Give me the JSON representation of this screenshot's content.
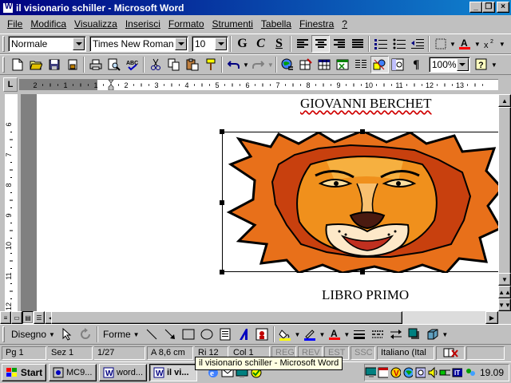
{
  "window": {
    "title": "il visionario schiller - Microsoft Word",
    "minimize_glyph": "_",
    "restore_glyph": "❐",
    "close_glyph": "×"
  },
  "menu": [
    {
      "label": "File",
      "name": "menu-file"
    },
    {
      "label": "Modifica",
      "name": "menu-modifica"
    },
    {
      "label": "Visualizza",
      "name": "menu-visualizza"
    },
    {
      "label": "Inserisci",
      "name": "menu-inserisci"
    },
    {
      "label": "Formato",
      "name": "menu-formato"
    },
    {
      "label": "Strumenti",
      "name": "menu-strumenti"
    },
    {
      "label": "Tabella",
      "name": "menu-tabella"
    },
    {
      "label": "Finestra",
      "name": "menu-finestra"
    },
    {
      "label": "?",
      "name": "menu-help"
    }
  ],
  "formatting": {
    "style": "Normale",
    "font": "Times New Roman",
    "size": "10",
    "bold": "G",
    "italic": "C",
    "underline": "S"
  },
  "standard": {
    "zoom": "100%",
    "help": "?"
  },
  "ruler": {
    "tab_selector": "L",
    "labels": [
      "2",
      "1",
      "1",
      "2",
      "3",
      "4",
      "5",
      "6",
      "7",
      "8",
      "9",
      "10",
      "11",
      "12",
      "13"
    ],
    "vlabels": [
      "6",
      "7",
      "8",
      "9",
      "10",
      "11",
      "12"
    ]
  },
  "document": {
    "heading_top": "GIOVANNI BERCHET",
    "heading_bottom": "LIBRO PRIMO"
  },
  "drawing": {
    "draw_label": "Disegno",
    "shapes_label": "Forme"
  },
  "status": {
    "page": "Pg 1",
    "section": "Sez 1",
    "pages": "1/27",
    "at": "A 8,6 cm",
    "line": "Ri 12",
    "col": "Col 1",
    "reg": "REG",
    "rev": "REV",
    "est": "EST",
    "ssc": "SSC",
    "language": "Italiano (Ital"
  },
  "taskbar": {
    "start": "Start",
    "buttons": [
      {
        "label": "MC9...",
        "active": false
      },
      {
        "label": "word...",
        "active": false
      },
      {
        "label": "il vi...",
        "active": true
      }
    ],
    "clock": "19.09"
  },
  "tooltip": "il visionario schiller - Microsoft Word",
  "colors": {
    "title_start": "#000080",
    "title_end": "#1084d0",
    "face": "#c0c0c0",
    "font_color_bar": "#ff0000",
    "highlight_bar": "#ffff00",
    "line_color_bar": "#0000ff"
  }
}
